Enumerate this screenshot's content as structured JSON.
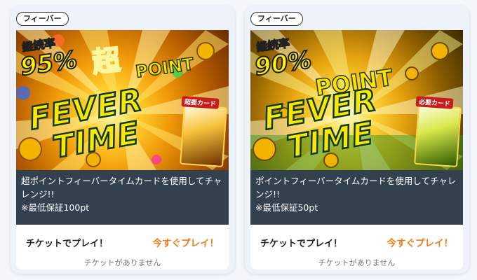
{
  "cards": [
    {
      "badge": "フィーバー",
      "banner": {
        "rate_label": "継続率",
        "rate": "95%",
        "super": "超",
        "point": "POINT",
        "fever": "FEVER",
        "time": "TIME",
        "card_label": "超要カード",
        "theme": "gold"
      },
      "description_line1": "超ポイントフィーバータイムカードを使用してチャレンジ!!",
      "description_line2": "※最低保証100pt",
      "ticket_label": "チケットでプレイ！",
      "play_label": "今すぐプレイ！",
      "no_ticket": "チケットがありません"
    },
    {
      "badge": "フィーバー",
      "banner": {
        "rate_label": "継続率",
        "rate": "90%",
        "point": "POINT",
        "fever": "FEVER",
        "time": "TIME",
        "card_label": "必要カード",
        "theme": "green"
      },
      "description_line1": "ポイントフィーバータイムカードを使用してチャレンジ!!",
      "description_line2": "※最低保証50pt",
      "ticket_label": "チケットでプレイ！",
      "play_label": "今すぐプレイ！",
      "no_ticket": "チケットがありません"
    }
  ],
  "colors": {
    "accent": "#f07c13",
    "description_bg": "#33414f",
    "page_bg": "#f3f6fb"
  }
}
